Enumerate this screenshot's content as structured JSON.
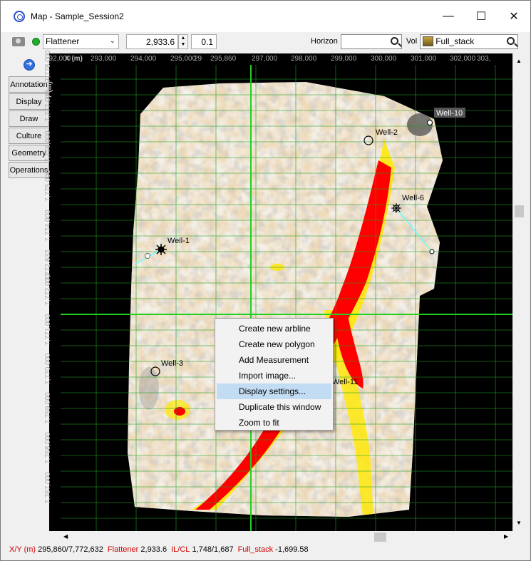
{
  "window": {
    "title": "Map - Sample_Session2",
    "controls": {
      "minimize": "—",
      "maximize": "☐",
      "close": "✕"
    }
  },
  "toolbar": {
    "layer_select": "Flattener",
    "value": "2,933.6",
    "step": "0.1",
    "horizon_label": "Horizon",
    "horizon_value": "",
    "vol_label": "Vol",
    "vol_value": "Full_stack"
  },
  "side_tabs": [
    "Annotation",
    "Display",
    "Draw",
    "Culture",
    "Geometry",
    "Operations"
  ],
  "axes": {
    "x_title": "X (m)",
    "y_title": "Y (m)",
    "x_ticks": [
      "292,000",
      "293,000",
      "294,000",
      "295,000",
      "29",
      "295,860",
      "297,000",
      "298,000",
      "299,000",
      "300,000",
      "301,000",
      "302,000",
      "303,"
    ],
    "y_ticks": [
      "7,778,000",
      "7,777,000",
      "7,776,000",
      "7,775,000",
      "7,774,000",
      "7,772,632",
      "7,772,000",
      "7,771,000",
      "7,770,000",
      "7,769,000",
      "7,768,000",
      "7,767,000"
    ]
  },
  "wells": [
    "Well-1",
    "Well-2",
    "Well-3",
    "Well-6",
    "Well-10",
    "Well-11"
  ],
  "context_menu": {
    "items": [
      "Create new arbline",
      "Create new polygon",
      "Add Measurement",
      "Import image...",
      "Display settings...",
      "Duplicate this window",
      "Zoom to fit"
    ],
    "highlighted": "Display settings..."
  },
  "status": {
    "xy_label": "X/Y (m)",
    "xy_value": "295,860/7,772,632",
    "flattener_label": "Flattener",
    "flattener_value": "2,933.6",
    "ilcl_label": "IL/CL",
    "ilcl_value": "1,748/1,687",
    "vol_label": "Full_stack",
    "vol_value": "-1,699.58"
  },
  "colors": {
    "crosshair": "#22d022",
    "grid": "#20a020",
    "amplitude_high": "#ff0000",
    "amplitude_mid": "#ffe800",
    "background": "#000000"
  }
}
